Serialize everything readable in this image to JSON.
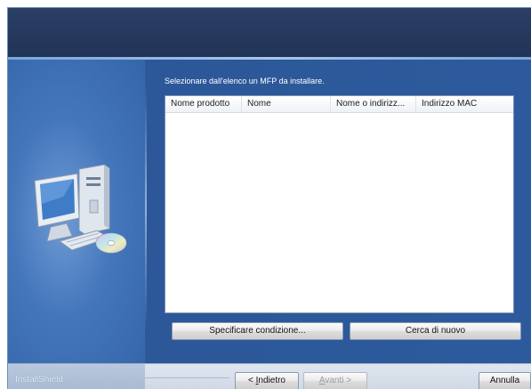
{
  "instruction": "Selezionare dall'elenco un MFP da installare.",
  "table": {
    "columns": [
      "Nome prodotto",
      "Nome",
      "Nome o indirizz...",
      "Indirizzo MAC"
    ],
    "rows": []
  },
  "buttons": {
    "specify": "Specificare condizione...",
    "search_again": "Cerca di nuovo",
    "back_prefix": "< ",
    "back_mnemonic": "I",
    "back_rest": "ndietro",
    "next_mnemonic": "A",
    "next_rest": "vanti >",
    "cancel": "Annulla"
  },
  "footer": {
    "brand": "InstallShield"
  },
  "icons": {
    "computer": "computer-cd-icon"
  },
  "colors": {
    "window_blue": "#2f5a98",
    "header_dark": "#213457"
  }
}
